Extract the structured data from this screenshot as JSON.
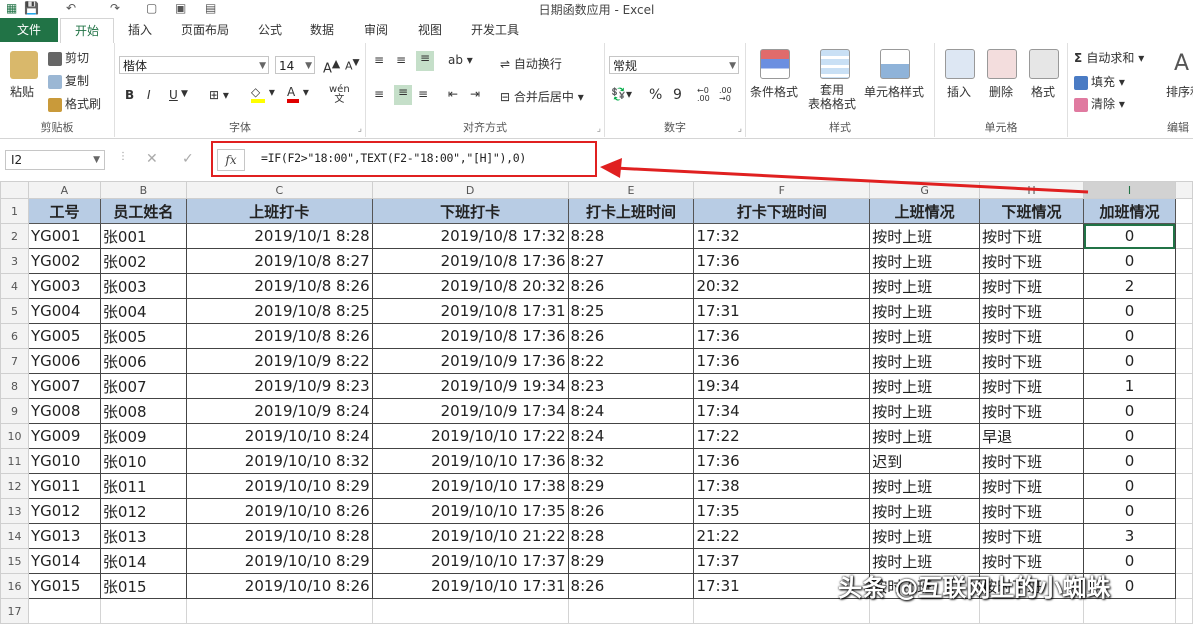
{
  "app": {
    "title": "日期函数应用 - Excel"
  },
  "tabs": [
    "文件",
    "开始",
    "插入",
    "页面布局",
    "公式",
    "数据",
    "审阅",
    "视图",
    "开发工具"
  ],
  "ribbon": {
    "clipboard": {
      "paste": "粘贴",
      "cut": "剪切",
      "copy": "复制",
      "format_painter": "格式刷",
      "label": "剪贴板"
    },
    "font": {
      "name": "楷体",
      "size": "14",
      "bold": "B",
      "italic": "I",
      "underline": "U",
      "wen": "wén",
      "label": "字体"
    },
    "alignment": {
      "wrap": "自动换行",
      "merge": "合并后居中",
      "label": "对齐方式"
    },
    "number": {
      "format": "常规",
      "percent": "%",
      "comma": "9",
      "label": "数字"
    },
    "styles": {
      "conditional": "条件格式",
      "table": "套用\n表格格式",
      "cell_styles": "单元格样式",
      "label": "样式"
    },
    "cells": {
      "insert": "插入",
      "delete": "删除",
      "format": "格式",
      "label": "单元格"
    },
    "editing": {
      "autosum": "自动求和",
      "fill": "填充",
      "clear": "清除",
      "sort": "排序和",
      "label": "编辑"
    }
  },
  "formula_bar": {
    "name_box": "I2",
    "fx": "fx",
    "formula": "=IF(F2>\"18:00\",TEXT(F2-\"18:00\",\"[H]\"),0)"
  },
  "sheet": {
    "columns": [
      "A",
      "B",
      "C",
      "D",
      "E",
      "F",
      "G",
      "H",
      "I"
    ],
    "headers": [
      "工号",
      "员工姓名",
      "上班打卡",
      "下班打卡",
      "打卡上班时间",
      "打卡下班时间",
      "上班情况",
      "下班情况",
      "加班情况"
    ],
    "rows": [
      [
        "YG001",
        "张001",
        "2019/10/1 8:28",
        "2019/10/8 17:32",
        "8:28",
        "17:32",
        "按时上班",
        "按时下班",
        "0"
      ],
      [
        "YG002",
        "张002",
        "2019/10/8 8:27",
        "2019/10/8 17:36",
        "8:27",
        "17:36",
        "按时上班",
        "按时下班",
        "0"
      ],
      [
        "YG003",
        "张003",
        "2019/10/8 8:26",
        "2019/10/8 20:32",
        "8:26",
        "20:32",
        "按时上班",
        "按时下班",
        "2"
      ],
      [
        "YG004",
        "张004",
        "2019/10/8 8:25",
        "2019/10/8 17:31",
        "8:25",
        "17:31",
        "按时上班",
        "按时下班",
        "0"
      ],
      [
        "YG005",
        "张005",
        "2019/10/8 8:26",
        "2019/10/8 17:36",
        "8:26",
        "17:36",
        "按时上班",
        "按时下班",
        "0"
      ],
      [
        "YG006",
        "张006",
        "2019/10/9 8:22",
        "2019/10/9 17:36",
        "8:22",
        "17:36",
        "按时上班",
        "按时下班",
        "0"
      ],
      [
        "YG007",
        "张007",
        "2019/10/9 8:23",
        "2019/10/9 19:34",
        "8:23",
        "19:34",
        "按时上班",
        "按时下班",
        "1"
      ],
      [
        "YG008",
        "张008",
        "2019/10/9 8:24",
        "2019/10/9 17:34",
        "8:24",
        "17:34",
        "按时上班",
        "按时下班",
        "0"
      ],
      [
        "YG009",
        "张009",
        "2019/10/10 8:24",
        "2019/10/10 17:22",
        "8:24",
        "17:22",
        "按时上班",
        "早退",
        "0"
      ],
      [
        "YG010",
        "张010",
        "2019/10/10 8:32",
        "2019/10/10 17:36",
        "8:32",
        "17:36",
        "迟到",
        "按时下班",
        "0"
      ],
      [
        "YG011",
        "张011",
        "2019/10/10 8:29",
        "2019/10/10 17:38",
        "8:29",
        "17:38",
        "按时上班",
        "按时下班",
        "0"
      ],
      [
        "YG012",
        "张012",
        "2019/10/10 8:26",
        "2019/10/10 17:35",
        "8:26",
        "17:35",
        "按时上班",
        "按时下班",
        "0"
      ],
      [
        "YG013",
        "张013",
        "2019/10/10 8:28",
        "2019/10/10 21:22",
        "8:28",
        "21:22",
        "按时上班",
        "按时下班",
        "3"
      ],
      [
        "YG014",
        "张014",
        "2019/10/10 8:29",
        "2019/10/10 17:37",
        "8:29",
        "17:37",
        "按时上班",
        "按时下班",
        "0"
      ],
      [
        "YG015",
        "张015",
        "2019/10/10 8:26",
        "2019/10/10 17:31",
        "8:26",
        "17:31",
        "按时上班",
        "按时下班",
        "0"
      ]
    ],
    "selected_cell": "I2"
  },
  "watermark": "头条 @互联网上的小蜘蛛",
  "colors": {
    "excel_green": "#217346",
    "header_fill": "#b8cce4",
    "annotation_red": "#e02020"
  }
}
